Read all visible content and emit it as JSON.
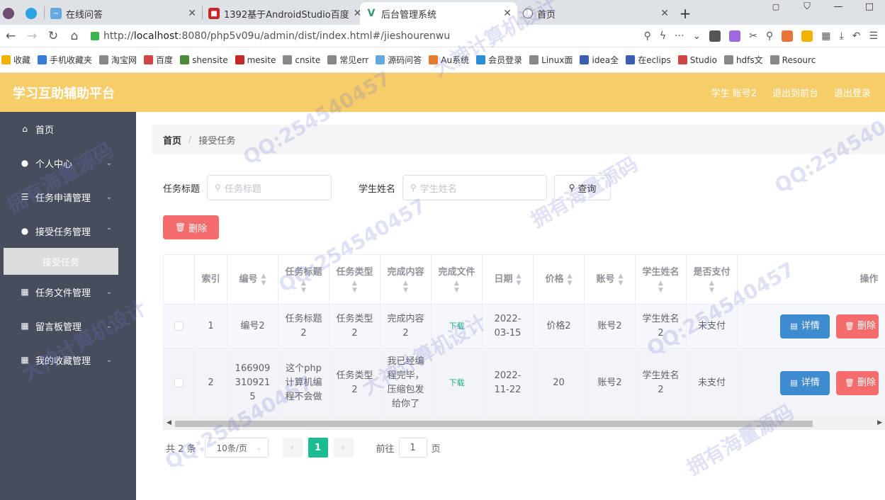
{
  "browser": {
    "tabs": [
      {
        "label": "在线问答"
      },
      {
        "label": "1392基于AndroidStudio百度"
      },
      {
        "label": "后台管理系统"
      },
      {
        "label": "首页"
      }
    ],
    "url_prefix": "http://",
    "url_host": "localhost",
    "url_rest": ":8080/php5v09u/admin/dist/index.html#/jieshourenwu",
    "bookmarks": [
      "收藏",
      "手机收藏夹",
      "淘宝网",
      "百度",
      "shensite",
      "mesite",
      "cnsite",
      "常见err",
      "源码问答",
      "Au系统",
      "会员登录",
      "Linux面",
      "idea全",
      "在eclips",
      "Studio",
      "hdfs文",
      "Resourc"
    ]
  },
  "header": {
    "brand": "学习互助辅助平台",
    "user": "学生 账号2",
    "exit_front": "退出到前台",
    "logout": "退出登录"
  },
  "sidebar": {
    "items": [
      {
        "label": "首页",
        "icon": "home-icon",
        "expandable": false
      },
      {
        "label": "个人中心",
        "icon": "user-icon",
        "expandable": true
      },
      {
        "label": "任务申请管理",
        "icon": "list-icon",
        "expandable": true
      },
      {
        "label": "接受任务管理",
        "icon": "user-icon",
        "expandable": true
      },
      {
        "label": "任务文件管理",
        "icon": "grid-icon",
        "expandable": true
      },
      {
        "label": "留言板管理",
        "icon": "grid-icon",
        "expandable": true
      },
      {
        "label": "我的收藏管理",
        "icon": "grid-icon",
        "expandable": true
      }
    ],
    "active_sub": "接受任务"
  },
  "breadcrumb": {
    "home": "首页",
    "current": "接受任务"
  },
  "search": {
    "title_label": "任务标题",
    "title_placeholder": "任务标题",
    "student_label": "学生姓名",
    "student_placeholder": "学生姓名",
    "query_button": "查询"
  },
  "delete_button": "删除",
  "table": {
    "headers": [
      "索引",
      "编号",
      "任务标题",
      "任务类型",
      "完成内容",
      "完成文件",
      "日期",
      "价格",
      "账号",
      "学生姓名",
      "是否支付",
      "操作"
    ],
    "rows": [
      {
        "index": "1",
        "code": "编号2",
        "title": "任务标题2",
        "type": "任务类型2",
        "content": "完成内容2",
        "file": "下载",
        "date": "2022-03-15",
        "price": "价格2",
        "account": "账号2",
        "student": "学生姓名2",
        "paid": "未支付"
      },
      {
        "index": "2",
        "code": "1669093109215",
        "title": "这个php计算机编程不会做",
        "type": "任务类型2",
        "content": "我已经编程完毕，压缩包发给你了",
        "file": "下载",
        "date": "2022-11-22",
        "price": "20",
        "account": "账号2",
        "student": "学生姓名2",
        "paid": "未支付"
      }
    ],
    "detail_button": "详情",
    "row_delete_button": "删除"
  },
  "pagination": {
    "total": "共 2 条",
    "page_size": "10条/页",
    "current_page": "1",
    "goto_label": "前往",
    "goto_value": "1",
    "page_suffix": "页"
  },
  "watermarks": [
    "QQ:254540457",
    "大神计算机设计",
    "拥有海量源码"
  ]
}
